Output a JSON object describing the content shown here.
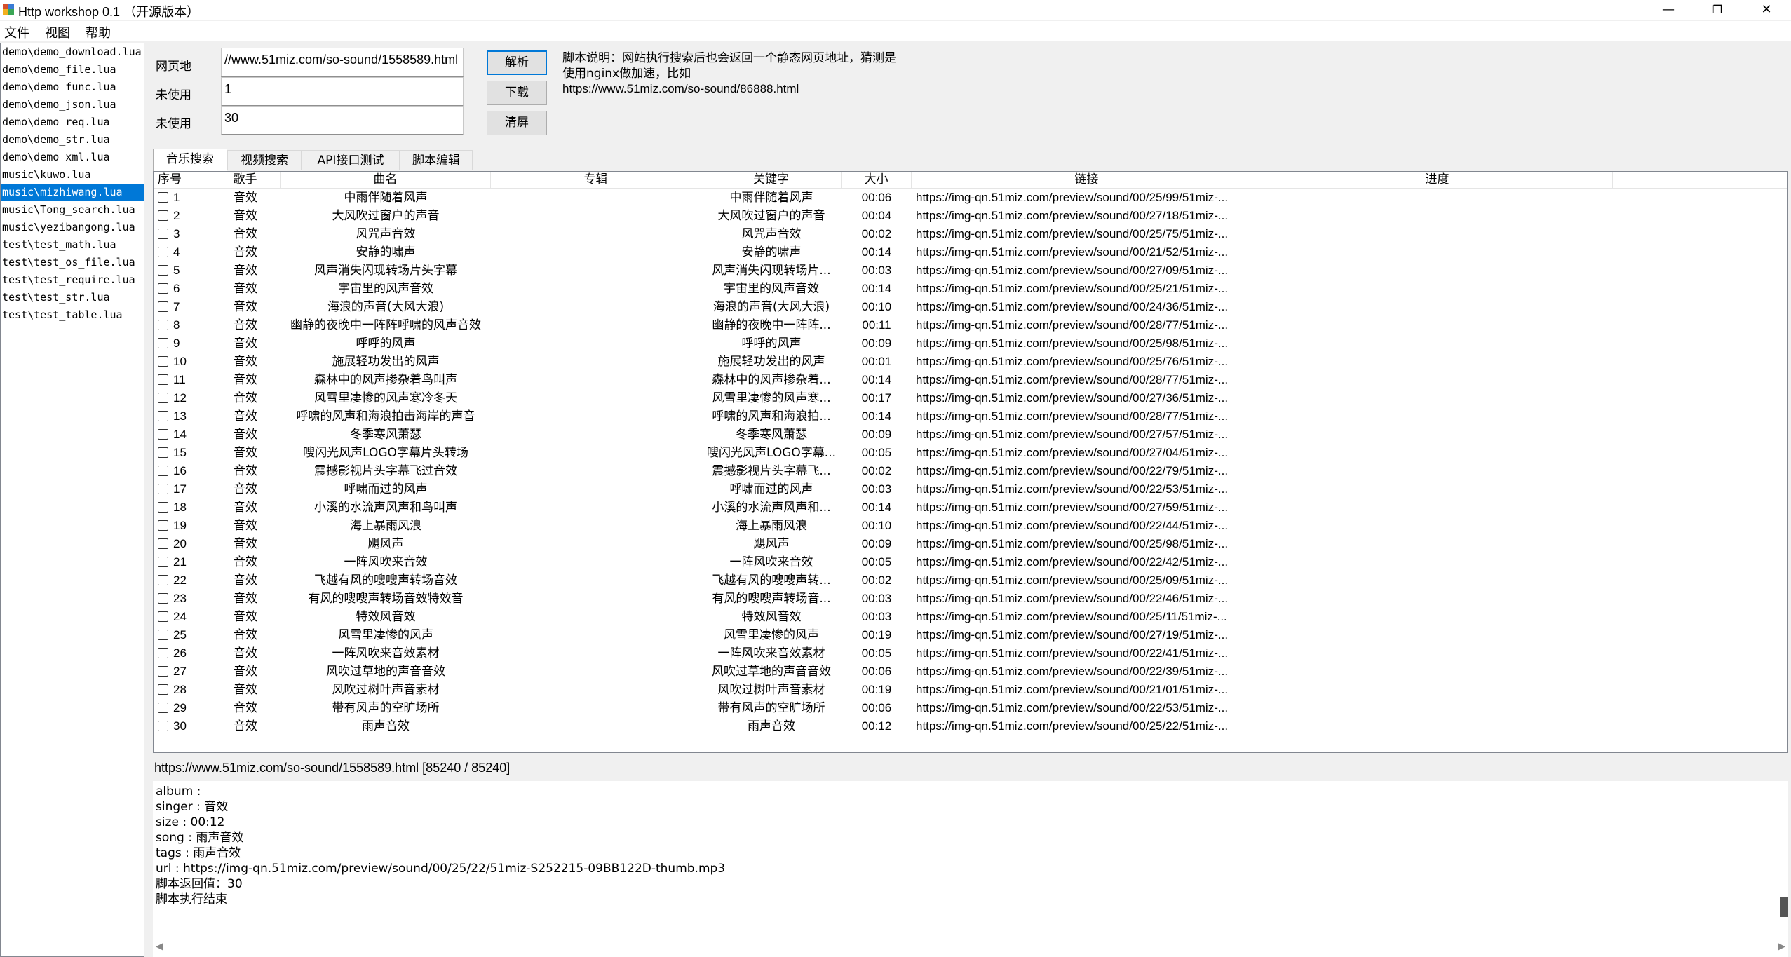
{
  "window": {
    "title": "Http workshop 0.1  （开源版本）",
    "controls": {
      "minimize": "—",
      "maximize": "❐",
      "close": "✕"
    }
  },
  "menu": [
    "文件",
    "视图",
    "帮助"
  ],
  "file_list": {
    "items": [
      "demo\\demo_download.lua",
      "demo\\demo_file.lua",
      "demo\\demo_func.lua",
      "demo\\demo_json.lua",
      "demo\\demo_req.lua",
      "demo\\demo_str.lua",
      "demo\\demo_xml.lua",
      "music\\kuwo.lua",
      "music\\mizhiwang.lua",
      "music\\Tong_search.lua",
      "music\\yezibangong.lua",
      "test\\test_math.lua",
      "test\\test_os_file.lua",
      "test\\test_require.lua",
      "test\\test_str.lua",
      "test\\test_table.lua"
    ],
    "selected_index": 8
  },
  "form": {
    "url_label": "网页地",
    "url_value": "//www.51miz.com/so-sound/1558589.html",
    "unused1_label": "未使用",
    "unused1_value": "1",
    "unused2_label": "未使用",
    "unused2_value": "30",
    "parse_button": "解析",
    "download_button": "下载",
    "clear_button": "清屏",
    "description": "脚本说明：网站执行搜索后也会返回一个静态网页地址，猜测是使用nginx做加速，比如",
    "description_url": "https://www.51miz.com/so-sound/86888.html"
  },
  "tabs": [
    "音乐搜索",
    "视频搜索",
    "API接口测试",
    "脚本编辑"
  ],
  "active_tab": 0,
  "table": {
    "columns": [
      "序号",
      "歌手",
      "曲名",
      "专辑",
      "关键字",
      "大小",
      "链接",
      "进度"
    ],
    "rows": [
      {
        "n": "1",
        "singer": "音效",
        "song": "中雨伴随着风声",
        "album": "",
        "kw": "中雨伴随着风声",
        "size": "00:06",
        "url": "https://img-qn.51miz.com/preview/sound/00/25/99/51miz-..."
      },
      {
        "n": "2",
        "singer": "音效",
        "song": "大风吹过窗户的声音",
        "album": "",
        "kw": "大风吹过窗户的声音",
        "size": "00:04",
        "url": "https://img-qn.51miz.com/preview/sound/00/27/18/51miz-..."
      },
      {
        "n": "3",
        "singer": "音效",
        "song": "风咒声音效",
        "album": "",
        "kw": "风咒声音效",
        "size": "00:02",
        "url": "https://img-qn.51miz.com/preview/sound/00/25/75/51miz-..."
      },
      {
        "n": "4",
        "singer": "音效",
        "song": "安静的啸声",
        "album": "",
        "kw": "安静的啸声",
        "size": "00:14",
        "url": "https://img-qn.51miz.com/preview/sound/00/21/52/51miz-..."
      },
      {
        "n": "5",
        "singer": "音效",
        "song": "风声消失闪现转场片头字幕",
        "album": "",
        "kw": "风声消失闪现转场片...",
        "size": "00:03",
        "url": "https://img-qn.51miz.com/preview/sound/00/27/09/51miz-..."
      },
      {
        "n": "6",
        "singer": "音效",
        "song": "宇宙里的风声音效",
        "album": "",
        "kw": "宇宙里的风声音效",
        "size": "00:14",
        "url": "https://img-qn.51miz.com/preview/sound/00/25/21/51miz-..."
      },
      {
        "n": "7",
        "singer": "音效",
        "song": "海浪的声音(大风大浪)",
        "album": "",
        "kw": "海浪的声音(大风大浪)",
        "size": "00:10",
        "url": "https://img-qn.51miz.com/preview/sound/00/24/36/51miz-..."
      },
      {
        "n": "8",
        "singer": "音效",
        "song": "幽静的夜晚中一阵阵呼啸的风声音效",
        "album": "",
        "kw": "幽静的夜晚中一阵阵...",
        "size": "00:11",
        "url": "https://img-qn.51miz.com/preview/sound/00/28/77/51miz-..."
      },
      {
        "n": "9",
        "singer": "音效",
        "song": "呼呼的风声",
        "album": "",
        "kw": "呼呼的风声",
        "size": "00:09",
        "url": "https://img-qn.51miz.com/preview/sound/00/25/98/51miz-..."
      },
      {
        "n": "10",
        "singer": "音效",
        "song": "施展轻功发出的风声",
        "album": "",
        "kw": "施展轻功发出的风声",
        "size": "00:01",
        "url": "https://img-qn.51miz.com/preview/sound/00/25/76/51miz-..."
      },
      {
        "n": "11",
        "singer": "音效",
        "song": "森林中的风声掺杂着鸟叫声",
        "album": "",
        "kw": "森林中的风声掺杂着...",
        "size": "00:14",
        "url": "https://img-qn.51miz.com/preview/sound/00/28/77/51miz-..."
      },
      {
        "n": "12",
        "singer": "音效",
        "song": "风雪里凄惨的风声寒冷冬天",
        "album": "",
        "kw": "风雪里凄惨的风声寒...",
        "size": "00:17",
        "url": "https://img-qn.51miz.com/preview/sound/00/27/36/51miz-..."
      },
      {
        "n": "13",
        "singer": "音效",
        "song": "呼啸的风声和海浪拍击海岸的声音",
        "album": "",
        "kw": "呼啸的风声和海浪拍...",
        "size": "00:14",
        "url": "https://img-qn.51miz.com/preview/sound/00/28/77/51miz-..."
      },
      {
        "n": "14",
        "singer": "音效",
        "song": "冬季寒风萧瑟",
        "album": "",
        "kw": "冬季寒风萧瑟",
        "size": "00:09",
        "url": "https://img-qn.51miz.com/preview/sound/00/27/57/51miz-..."
      },
      {
        "n": "15",
        "singer": "音效",
        "song": "嗖闪光风声LOGO字幕片头转场",
        "album": "",
        "kw": "嗖闪光风声LOGO字幕...",
        "size": "00:05",
        "url": "https://img-qn.51miz.com/preview/sound/00/27/04/51miz-..."
      },
      {
        "n": "16",
        "singer": "音效",
        "song": "震撼影视片头字幕飞过音效",
        "album": "",
        "kw": "震撼影视片头字幕飞...",
        "size": "00:02",
        "url": "https://img-qn.51miz.com/preview/sound/00/22/79/51miz-..."
      },
      {
        "n": "17",
        "singer": "音效",
        "song": "呼啸而过的风声",
        "album": "",
        "kw": "呼啸而过的风声",
        "size": "00:03",
        "url": "https://img-qn.51miz.com/preview/sound/00/22/53/51miz-..."
      },
      {
        "n": "18",
        "singer": "音效",
        "song": "小溪的水流声风声和鸟叫声",
        "album": "",
        "kw": "小溪的水流声风声和...",
        "size": "00:14",
        "url": "https://img-qn.51miz.com/preview/sound/00/27/59/51miz-..."
      },
      {
        "n": "19",
        "singer": "音效",
        "song": "海上暴雨风浪",
        "album": "",
        "kw": "海上暴雨风浪",
        "size": "00:10",
        "url": "https://img-qn.51miz.com/preview/sound/00/22/44/51miz-..."
      },
      {
        "n": "20",
        "singer": "音效",
        "song": "飓风声",
        "album": "",
        "kw": "飓风声",
        "size": "00:09",
        "url": "https://img-qn.51miz.com/preview/sound/00/25/98/51miz-..."
      },
      {
        "n": "21",
        "singer": "音效",
        "song": "一阵风吹来音效",
        "album": "",
        "kw": "一阵风吹来音效",
        "size": "00:05",
        "url": "https://img-qn.51miz.com/preview/sound/00/22/42/51miz-..."
      },
      {
        "n": "22",
        "singer": "音效",
        "song": "飞越有风的嗖嗖声转场音效",
        "album": "",
        "kw": "飞越有风的嗖嗖声转...",
        "size": "00:02",
        "url": "https://img-qn.51miz.com/preview/sound/00/25/09/51miz-..."
      },
      {
        "n": "23",
        "singer": "音效",
        "song": "有风的嗖嗖声转场音效特效音",
        "album": "",
        "kw": "有风的嗖嗖声转场音...",
        "size": "00:03",
        "url": "https://img-qn.51miz.com/preview/sound/00/22/46/51miz-..."
      },
      {
        "n": "24",
        "singer": "音效",
        "song": "特效风音效",
        "album": "",
        "kw": "特效风音效",
        "size": "00:03",
        "url": "https://img-qn.51miz.com/preview/sound/00/25/11/51miz-..."
      },
      {
        "n": "25",
        "singer": "音效",
        "song": "风雪里凄惨的风声",
        "album": "",
        "kw": "风雪里凄惨的风声",
        "size": "00:19",
        "url": "https://img-qn.51miz.com/preview/sound/00/27/19/51miz-..."
      },
      {
        "n": "26",
        "singer": "音效",
        "song": "一阵风吹来音效素材",
        "album": "",
        "kw": "一阵风吹来音效素材",
        "size": "00:05",
        "url": "https://img-qn.51miz.com/preview/sound/00/22/41/51miz-..."
      },
      {
        "n": "27",
        "singer": "音效",
        "song": "风吹过草地的声音音效",
        "album": "",
        "kw": "风吹过草地的声音音效",
        "size": "00:06",
        "url": "https://img-qn.51miz.com/preview/sound/00/22/39/51miz-..."
      },
      {
        "n": "28",
        "singer": "音效",
        "song": "风吹过树叶声音素材",
        "album": "",
        "kw": "风吹过树叶声音素材",
        "size": "00:19",
        "url": "https://img-qn.51miz.com/preview/sound/00/21/01/51miz-..."
      },
      {
        "n": "29",
        "singer": "音效",
        "song": "带有风声的空旷场所",
        "album": "",
        "kw": "带有风声的空旷场所",
        "size": "00:06",
        "url": "https://img-qn.51miz.com/preview/sound/00/22/53/51miz-..."
      },
      {
        "n": "30",
        "singer": "音效",
        "song": "雨声音效",
        "album": "",
        "kw": "雨声音效",
        "size": "00:12",
        "url": "https://img-qn.51miz.com/preview/sound/00/25/22/51miz-..."
      }
    ]
  },
  "status": "https://www.51miz.com/so-sound/1558589.html    [85240 / 85240]",
  "output": [
    "album :",
    "singer : 音效",
    "size : 00:12",
    "song : 雨声音效",
    "tags : 雨声音效",
    "url : https://img-qn.51miz.com/preview/sound/00/25/22/51miz-S252215-09BB122D-thumb.mp3",
    "脚本返回值：30",
    "脚本执行结束"
  ],
  "scroll_arrows": {
    "left": "◀",
    "right": "▶"
  }
}
